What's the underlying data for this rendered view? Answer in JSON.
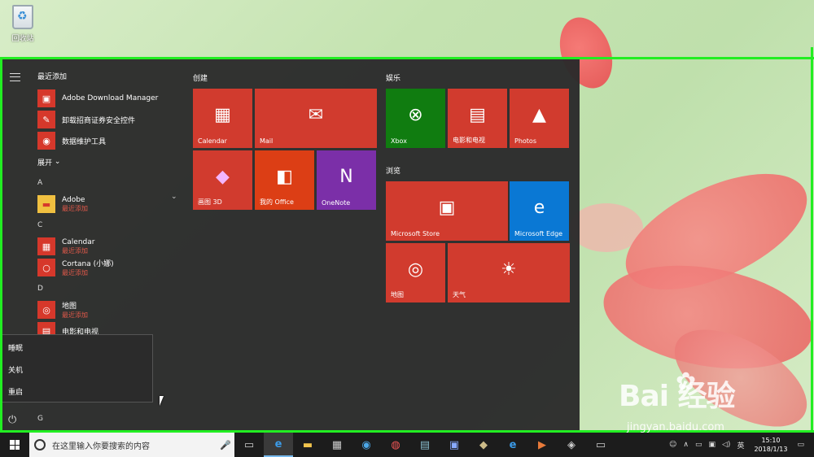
{
  "desktop": {
    "recycle_bin_label": "回收站"
  },
  "start_menu": {
    "recent_title": "最近添加",
    "recent_apps": [
      {
        "name": "Adobe Download Manager",
        "icon": "adobe-dm-icon"
      },
      {
        "name": "卸载招商证券安全控件",
        "icon": "uninstall-icon"
      },
      {
        "name": "数据维护工具",
        "icon": "data-tool-icon"
      }
    ],
    "expand_label": "展开",
    "letters": {
      "a": "A",
      "c": "C",
      "d": "D",
      "g": "G"
    },
    "apps_a": [
      {
        "name": "Adobe",
        "sub": "最近添加"
      }
    ],
    "apps_c": [
      {
        "name": "Calendar",
        "sub": "最近添加"
      },
      {
        "name": "Cortana (小娜)",
        "sub": "最近添加"
      }
    ],
    "apps_d": [
      {
        "name": "地图",
        "sub": "最近添加"
      },
      {
        "name": "电影和电视",
        "sub": ""
      }
    ],
    "groups": {
      "create": "创建",
      "entertainment": "娱乐",
      "browse": "浏览"
    },
    "tiles": {
      "calendar": "Calendar",
      "mail": "Mail",
      "paint3d": "画图 3D",
      "office": "我的 Office",
      "onenote": "OneNote",
      "xbox": "Xbox",
      "movies": "电影和电视",
      "photos": "Photos",
      "store": "Microsoft Store",
      "edge": "Microsoft Edge",
      "maps": "地图",
      "weather": "天气"
    },
    "tile_colors": {
      "red": "#d13b2e",
      "office": "#dc3e15",
      "onenote": "#7b2fa8",
      "xbox": "#107c10",
      "edge": "#0a78d4"
    }
  },
  "power_menu": {
    "sleep": "睡眠",
    "shutdown": "关机",
    "restart": "重启"
  },
  "taskbar": {
    "search_placeholder": "在这里输入你要搜索的内容",
    "clock_time": "15:10",
    "clock_date": "2018/1/13",
    "ime": "英"
  },
  "watermark": {
    "brand": "Bai  经验",
    "url": "jingyan.baidu.com"
  }
}
